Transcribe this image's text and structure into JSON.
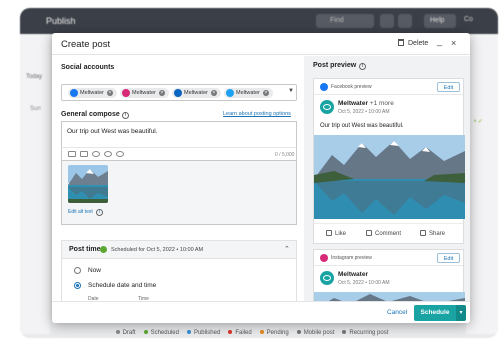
{
  "background": {
    "app_title": "Publish",
    "search_placeholder": "Find",
    "help_label": "Help",
    "top_right_label": "Co",
    "left_label_1": "Today",
    "left_label_2": "Sun",
    "legend": [
      {
        "label": "Draft",
        "color": "#8a8a8a"
      },
      {
        "label": "Scheduled",
        "color": "#5aa832"
      },
      {
        "label": "Published",
        "color": "#3b8fd4"
      },
      {
        "label": "Failed",
        "color": "#d9342b"
      },
      {
        "label": "Pending",
        "color": "#e38b1c"
      },
      {
        "label": "Mobile post",
        "color": "#777777"
      },
      {
        "label": "Recurring post",
        "color": "#777777"
      }
    ]
  },
  "modal": {
    "title": "Create post",
    "delete_label": "Delete",
    "minimize_glyph": "_",
    "close_glyph": "×",
    "social_accounts_label": "Social accounts",
    "accounts": [
      {
        "name": "Meltwater",
        "network": "facebook",
        "color": "#1877f2"
      },
      {
        "name": "Meltwater",
        "network": "instagram",
        "color": "#d62976"
      },
      {
        "name": "Meltwater",
        "network": "linkedin",
        "color": "#0a66c2"
      },
      {
        "name": "Meltwater",
        "network": "twitter",
        "color": "#1da1f2"
      }
    ],
    "general_compose_label": "General compose",
    "learn_link": "Learn about posting options",
    "compose_text": "Our trip out West was beautiful.",
    "char_count": "0 / 5,000",
    "edit_alt_text": "Edit alt text",
    "post_time": {
      "title": "Post time",
      "scheduled_text": "Scheduled for Oct 5, 2022 • 10:00 AM",
      "option_now": "Now",
      "option_schedule": "Schedule date and time",
      "date_label": "Date",
      "time_label": "Time"
    },
    "preview": {
      "title": "Post preview",
      "facebook": {
        "label": "Facebook preview",
        "edit": "Edit",
        "account_name": "Meltwater",
        "more": "+1 more",
        "date": "Oct 5, 2022 • 10:00 AM",
        "text": "Our trip out West was beautiful.",
        "actions": [
          "Like",
          "Comment",
          "Share"
        ]
      },
      "instagram": {
        "label": "Instagram preview",
        "edit": "Edit",
        "account_name": "Meltwater",
        "date": "Oct 5, 2022 • 10:00 AM"
      }
    },
    "footer": {
      "cancel": "Cancel",
      "schedule": "Schedule",
      "caret": "▾"
    }
  }
}
